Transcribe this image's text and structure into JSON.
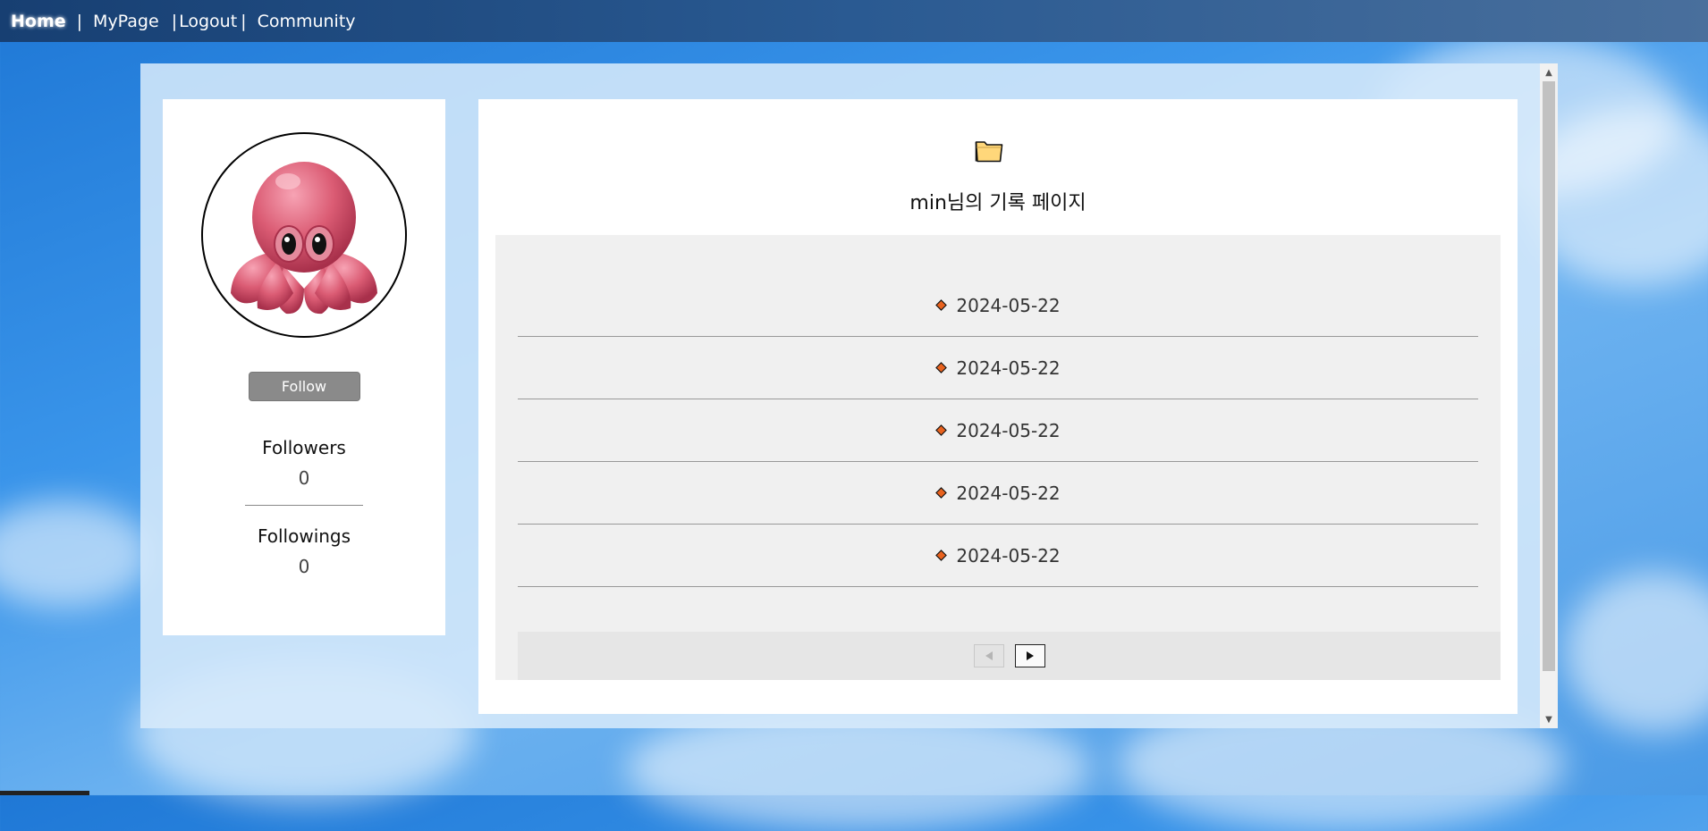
{
  "nav": {
    "home": "Home",
    "mypage": "MyPage",
    "logout": "Logout",
    "community": "Community",
    "sep": "|"
  },
  "profile": {
    "avatar_icon": "octopus-emoji-icon",
    "follow_label": "Follow",
    "followers_label": "Followers",
    "followers_count": "0",
    "followings_label": "Followings",
    "followings_count": "0"
  },
  "main": {
    "folder_icon": "folder-icon",
    "title": "min님의 기록 페이지",
    "records": [
      {
        "date": "2024-05-22"
      },
      {
        "date": "2024-05-22"
      },
      {
        "date": "2024-05-22"
      },
      {
        "date": "2024-05-22"
      },
      {
        "date": "2024-05-22"
      }
    ],
    "pager": {
      "prev_icon": "triangle-left-icon",
      "next_icon": "triangle-right-icon"
    }
  },
  "colors": {
    "topbar": "#173f72",
    "follow_button": "#8a8a8a",
    "diamond": "#e8621e",
    "folder": "#ffd77a",
    "record_bg": "#f0f0f0"
  }
}
